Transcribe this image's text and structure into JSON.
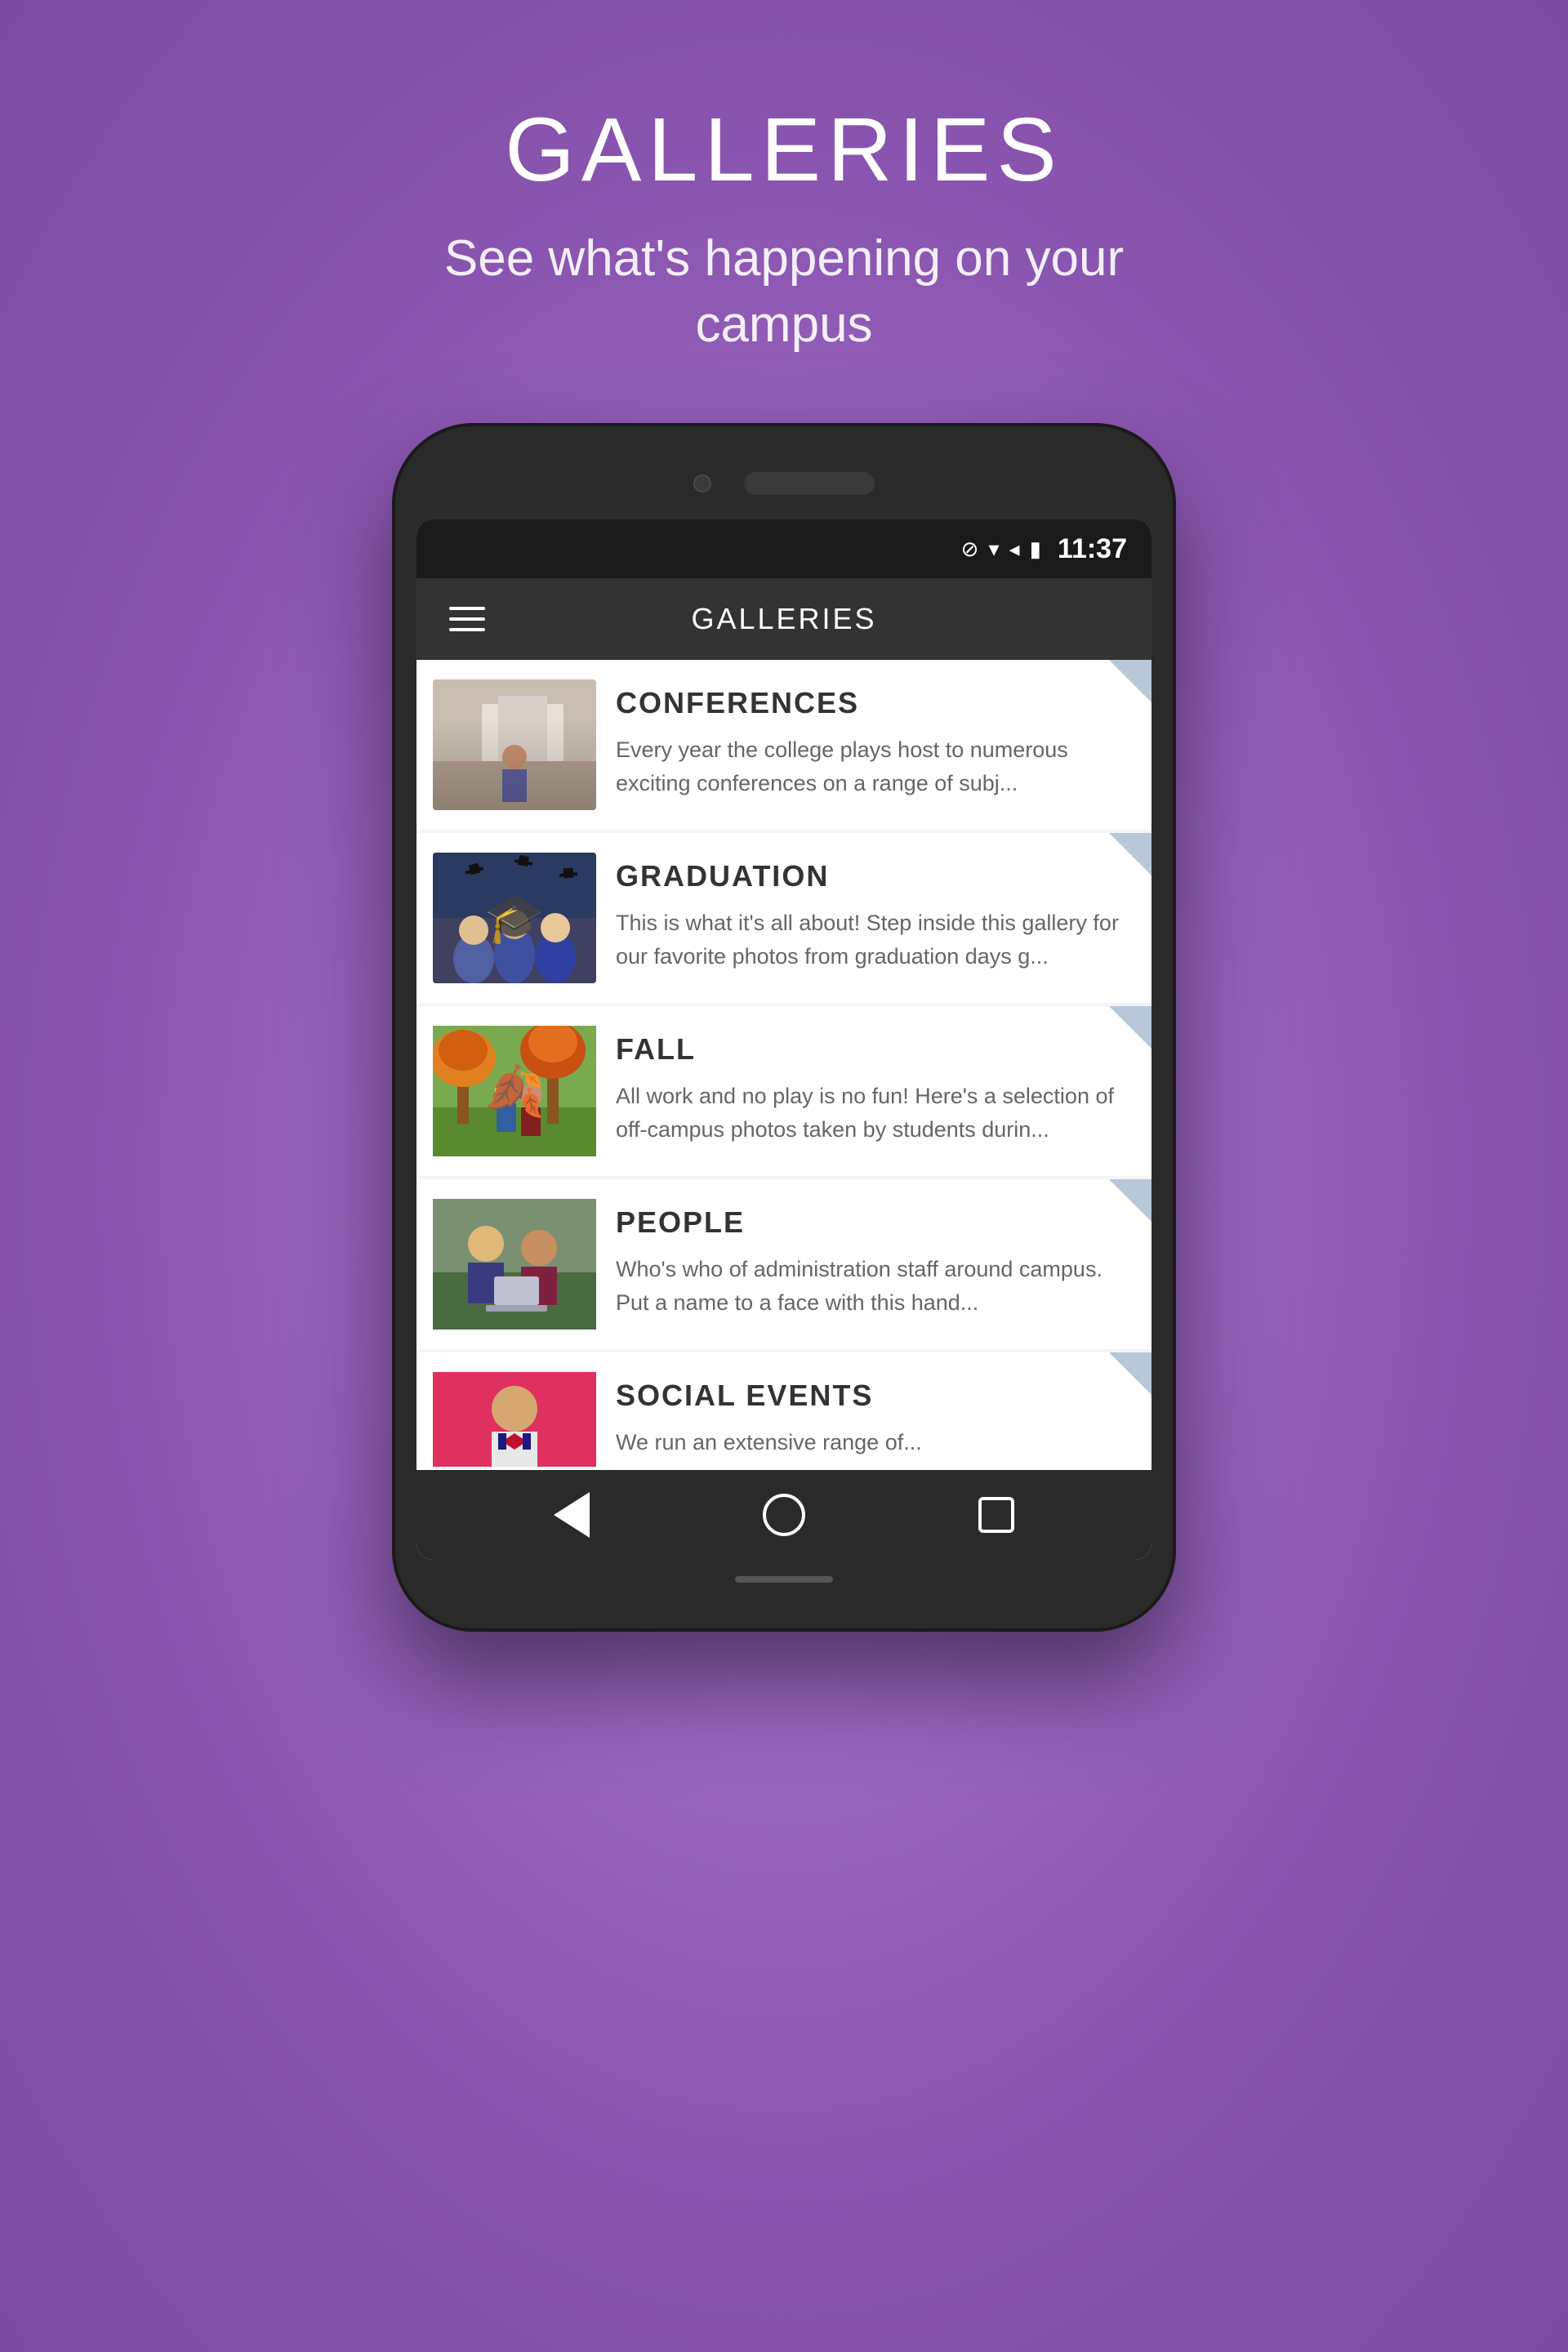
{
  "header": {
    "title": "GALLERIES",
    "subtitle": "See what's happening on your campus"
  },
  "statusBar": {
    "time": "11:37",
    "icons": [
      "⊘",
      "▼",
      "◀",
      "🔋"
    ]
  },
  "appBar": {
    "title": "GALLERIES"
  },
  "galleries": [
    {
      "id": "conferences",
      "title": "CONFERENCES",
      "description": "Every year the college plays host to numerous exciting conferences on a range of subj..."
    },
    {
      "id": "graduation",
      "title": "GRADUATION",
      "description": "This is what it's all about!  Step inside this gallery for our favorite photos from graduation days g..."
    },
    {
      "id": "fall",
      "title": "FALL",
      "description": "All work and no play is no fun!  Here's a selection of off-campus photos taken by students durin..."
    },
    {
      "id": "people",
      "title": "PEOPLE",
      "description": "Who's who of administration staff around campus.  Put a name to a face with this hand..."
    },
    {
      "id": "social-events",
      "title": "SOCIAL EVENTS",
      "description": "We run an extensive range of..."
    }
  ],
  "bottomNav": {
    "back": "back-icon",
    "home": "home-icon",
    "recent": "recent-apps-icon"
  }
}
